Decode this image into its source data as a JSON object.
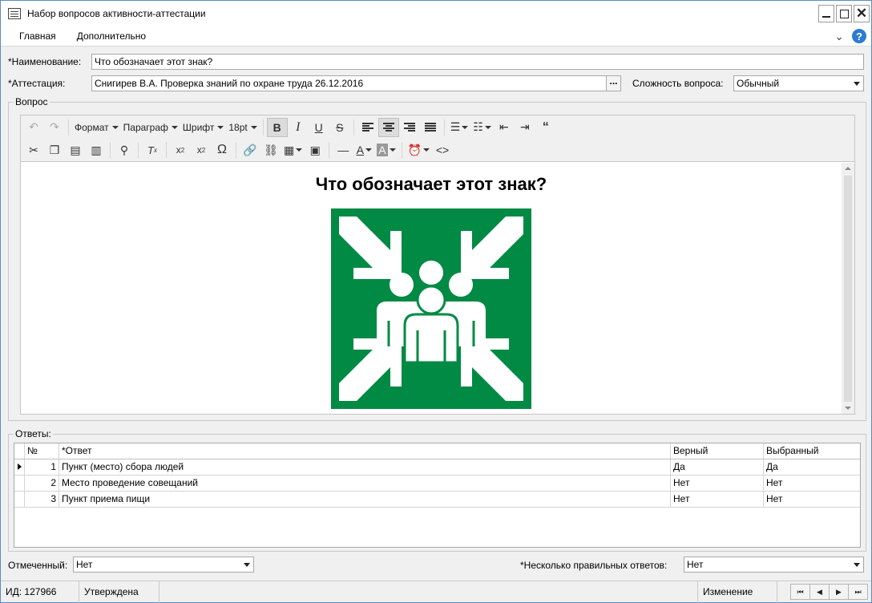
{
  "window": {
    "title": "Набор вопросов активности-аттестации",
    "buttons": {
      "minimize": "",
      "maximize": "",
      "close": "✕"
    }
  },
  "menu": {
    "items": [
      "Главная",
      "Дополнительно"
    ],
    "help": "?",
    "chevron": "⌄"
  },
  "form": {
    "name_label": "*Наименование:",
    "name_value": "Что обозначает этот знак?",
    "attestation_label": "*Аттестация:",
    "attestation_value": "Снигирев В.А. Проверка знаний по охране труда 26.12.2016",
    "ellipsis": "...",
    "difficulty_label": "Сложность вопроса:",
    "difficulty_value": "Обычный"
  },
  "question_group": {
    "title": "Вопрос"
  },
  "editor": {
    "toolbar1": {
      "format": "Формат",
      "paragraph": "Параграф",
      "font": "Шрифт",
      "size": "18pt",
      "bold": "B",
      "italic": "I",
      "underline": "U",
      "strike": "S",
      "quote": "66"
    },
    "toolbar2": {
      "omega": "Ω"
    },
    "content_heading": "Что обозначает этот знак?",
    "image_icon": "assembly-point-sign-icon"
  },
  "answers": {
    "title": "Ответы:",
    "columns": [
      "№",
      "*Ответ",
      "Верный",
      "Выбранный"
    ],
    "rows": [
      {
        "num": "1",
        "answer": "Пункт (место) сбора людей",
        "correct": "Да",
        "selected": "Да"
      },
      {
        "num": "2",
        "answer": "Место проведение совещаний",
        "correct": "Нет",
        "selected": "Нет"
      },
      {
        "num": "3",
        "answer": "Пункт приема пищи",
        "correct": "Нет",
        "selected": "Нет"
      }
    ]
  },
  "bottom": {
    "marked_label": "Отмеченный:",
    "marked_value": "Нет",
    "multi_label": "*Несколько правильных ответов:",
    "multi_value": "Нет"
  },
  "status": {
    "id": "ИД: 127966",
    "state": "Утверждена",
    "mode": "Изменение",
    "nav": [
      "⏮",
      "◀",
      "▶",
      "⏭"
    ]
  },
  "colors": {
    "sign_green": "#008a44",
    "accent": "#2d7bd1"
  }
}
